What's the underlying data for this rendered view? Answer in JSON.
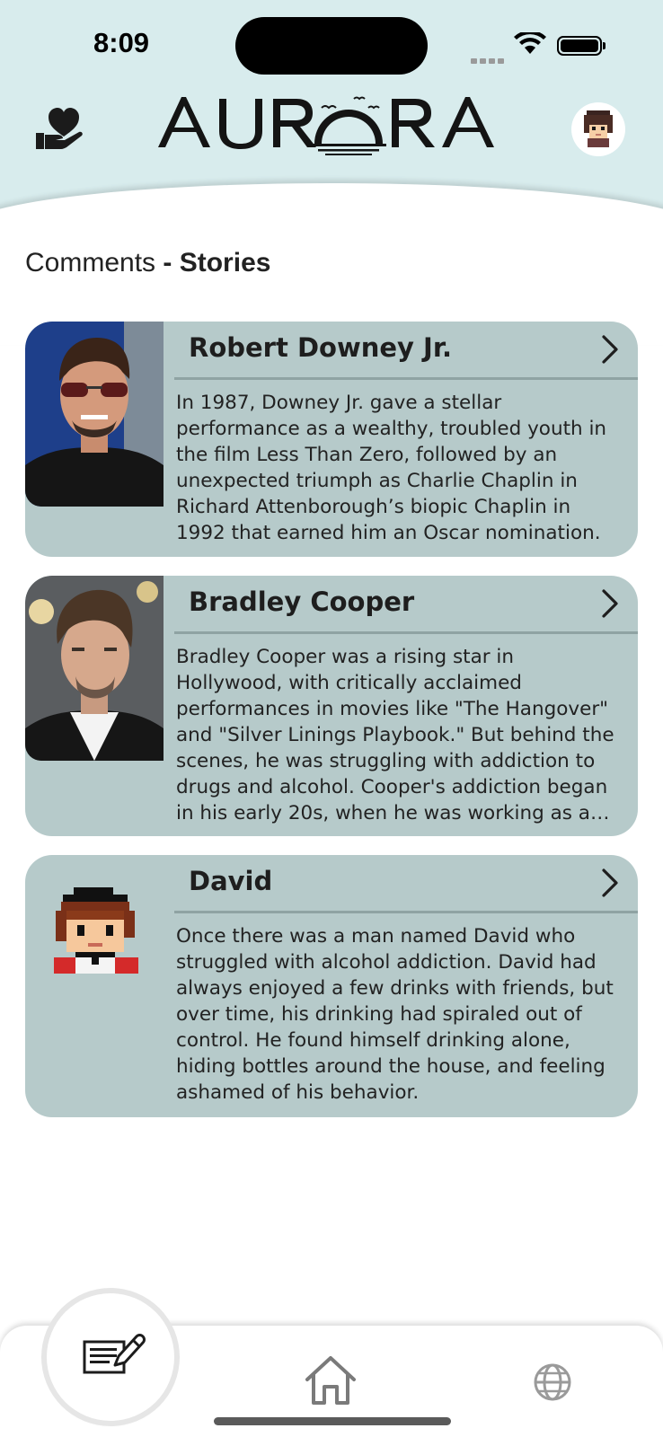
{
  "status_bar": {
    "time": "8:09"
  },
  "header": {
    "logo_text": "AURORA",
    "donate_icon": "heart-hand-icon",
    "profile_icon": "pixel-avatar-icon"
  },
  "page": {
    "title_part1": "Comments",
    "title_sep": "-",
    "title_part2": "Stories"
  },
  "stories": [
    {
      "name": "Robert Downey Jr.",
      "text": "In 1987, Downey Jr. gave a stellar performance as a wealthy, troubled youth in the film Less Than Zero, followed by an unexpected triumph as Charlie Chaplin in Richard Attenborough’s biopic Chaplin in 1992 that earned him an Oscar nomination."
    },
    {
      "name": "Bradley Cooper",
      "text": "Bradley Cooper was a rising star in Hollywood, with critically acclaimed performances in movies like \"The Hangover\" and \"Silver Linings Playbook.\" But behind the scenes, he was struggling with addiction to drugs and alcohol. Cooper's addiction began in his early 20s, when he was working as a struggling actor."
    },
    {
      "name": "David",
      "text": "Once there was a man named David who struggled with alcohol addiction. David had always enjoyed a few drinks with friends, but over time, his drinking had spiraled out of control. He found himself drinking alone, hiding bottles around the house, and feeling ashamed of his behavior."
    }
  ],
  "nav": {
    "compose_icon": "compose-icon",
    "home_icon": "home-icon",
    "globe_icon": "globe-icon"
  },
  "colors": {
    "header_bg": "#d8eced",
    "card_bg": "#b6caca",
    "divider": "#8fa3a3"
  }
}
